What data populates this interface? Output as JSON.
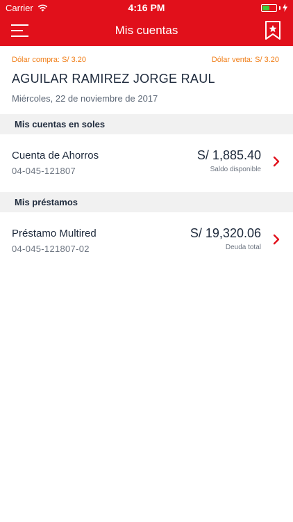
{
  "status_bar": {
    "carrier": "Carrier",
    "time": "4:16 PM"
  },
  "nav": {
    "title": "Mis cuentas"
  },
  "rates": {
    "buy": "Dólar compra: S/ 3.20",
    "sell": "Dólar venta: S/ 3.20"
  },
  "client": {
    "name": "AGUILAR RAMIREZ JORGE RAUL",
    "date": "Miércoles, 22 de noviembre de 2017"
  },
  "sections": [
    {
      "title": "Mis cuentas en soles",
      "item": {
        "name": "Cuenta de Ahorros",
        "number": "04-045-121807",
        "amount": "S/ 1,885.40",
        "amount_label": "Saldo disponible"
      }
    },
    {
      "title": "Mis préstamos",
      "item": {
        "name": "Préstamo Multired",
        "number": "04-045-121807-02",
        "amount": "S/ 19,320.06",
        "amount_label": "Deuda total"
      }
    }
  ],
  "colors": {
    "brand_red": "#e1101b",
    "rate_orange": "#f07d16",
    "text_dark": "#1e2a3c",
    "section_bg": "#f1f1f1"
  },
  "icons": [
    "wifi-icon",
    "battery-icon",
    "charging-icon",
    "menu-icon",
    "bookmark-star-icon",
    "chevron-right-icon"
  ]
}
